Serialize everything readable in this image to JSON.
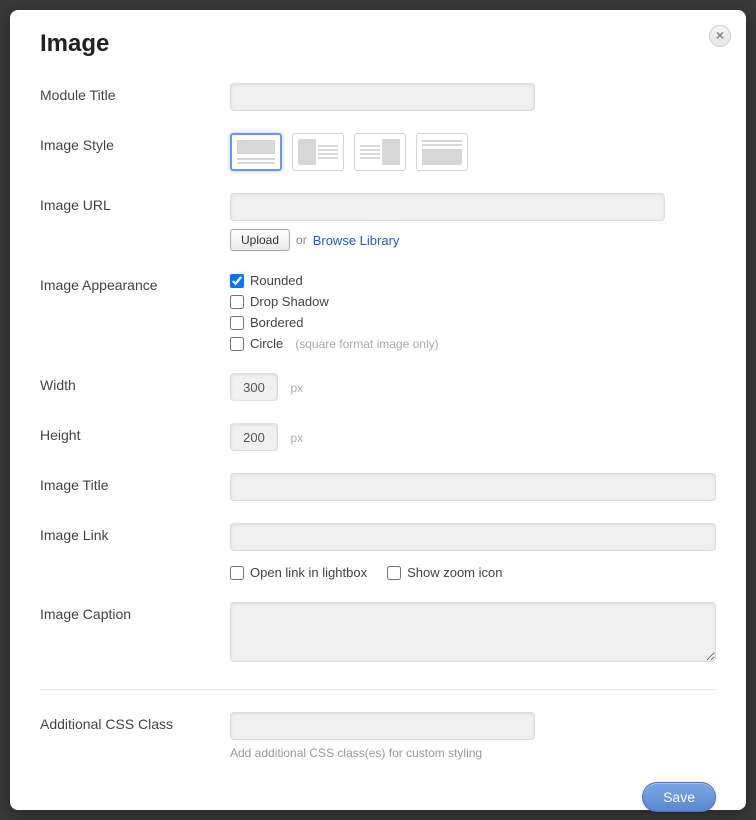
{
  "modal": {
    "title": "Image",
    "close_label": "×"
  },
  "fields": {
    "module_title": {
      "label": "Module Title",
      "value": ""
    },
    "image_style": {
      "label": "Image Style",
      "selected": 0
    },
    "image_url": {
      "label": "Image URL",
      "value": "",
      "upload_btn": "Upload",
      "or": "or",
      "browse": "Browse Library"
    },
    "appearance": {
      "label": "Image Appearance",
      "options": [
        {
          "label": "Rounded",
          "checked": true
        },
        {
          "label": "Drop Shadow",
          "checked": false
        },
        {
          "label": "Bordered",
          "checked": false
        },
        {
          "label": "Circle",
          "checked": false,
          "hint": "(square format image only)"
        }
      ]
    },
    "width": {
      "label": "Width",
      "value": "300",
      "unit": "px"
    },
    "height": {
      "label": "Height",
      "value": "200",
      "unit": "px"
    },
    "image_title": {
      "label": "Image Title",
      "value": ""
    },
    "image_link": {
      "label": "Image Link",
      "value": ""
    },
    "link_opts": {
      "lightbox": {
        "label": "Open link in lightbox",
        "checked": false
      },
      "zoom": {
        "label": "Show zoom icon",
        "checked": false
      }
    },
    "caption": {
      "label": "Image Caption",
      "value": ""
    },
    "css_class": {
      "label": "Additional CSS Class",
      "value": "",
      "help": "Add additional CSS class(es) for custom styling"
    }
  },
  "footer": {
    "save": "Save"
  }
}
